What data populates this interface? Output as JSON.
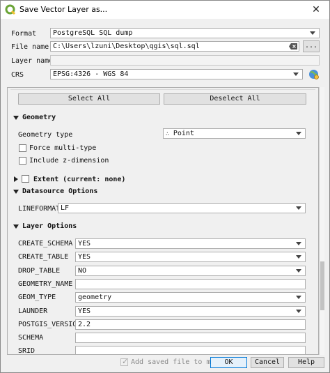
{
  "window": {
    "title": "Save Vector Layer as..."
  },
  "form": {
    "format_label": "Format",
    "format_value": "PostgreSQL SQL dump",
    "filename_label": "File name",
    "filename_value": "C:\\Users\\lzuni\\Desktop\\qgis\\sql.sql",
    "browse_label": "...",
    "layername_label": "Layer name",
    "layername_value": "",
    "crs_label": "CRS",
    "crs_value": "EPSG:4326 - WGS 84"
  },
  "select_all_label": "Select All",
  "deselect_all_label": "Deselect All",
  "geometry": {
    "header": "Geometry",
    "type_label": "Geometry type",
    "type_value": "Point",
    "force_multi_label": "Force multi-type",
    "include_z_label": "Include z-dimension"
  },
  "extent": {
    "header": "Extent (current: none)"
  },
  "datasource": {
    "header": "Datasource Options",
    "lineformat_label": "LINEFORMAT",
    "lineformat_value": "LF"
  },
  "layer_options": {
    "header": "Layer Options",
    "rows": [
      {
        "label": "CREATE_SCHEMA",
        "value": "YES",
        "kind": "combo"
      },
      {
        "label": "CREATE_TABLE",
        "value": "YES",
        "kind": "combo"
      },
      {
        "label": "DROP_TABLE",
        "value": "NO",
        "kind": "combo"
      },
      {
        "label": "GEOMETRY_NAME",
        "value": "",
        "kind": "field"
      },
      {
        "label": "GEOM_TYPE",
        "value": "geometry",
        "kind": "combo"
      },
      {
        "label": "LAUNDER",
        "value": "YES",
        "kind": "combo"
      },
      {
        "label": "POSTGIS_VERSION",
        "value": "2.2",
        "kind": "field"
      },
      {
        "label": "SCHEMA",
        "value": "",
        "kind": "field"
      },
      {
        "label": "SRID",
        "value": "",
        "kind": "field"
      }
    ]
  },
  "footer": {
    "add_to_map_label": "Add saved file to map",
    "ok_label": "OK",
    "cancel_label": "Cancel",
    "help_label": "Help"
  },
  "icons": [
    "qgis-logo-icon",
    "close-icon",
    "clear-text-icon",
    "crs-globe-icon",
    "point-type-icon"
  ]
}
